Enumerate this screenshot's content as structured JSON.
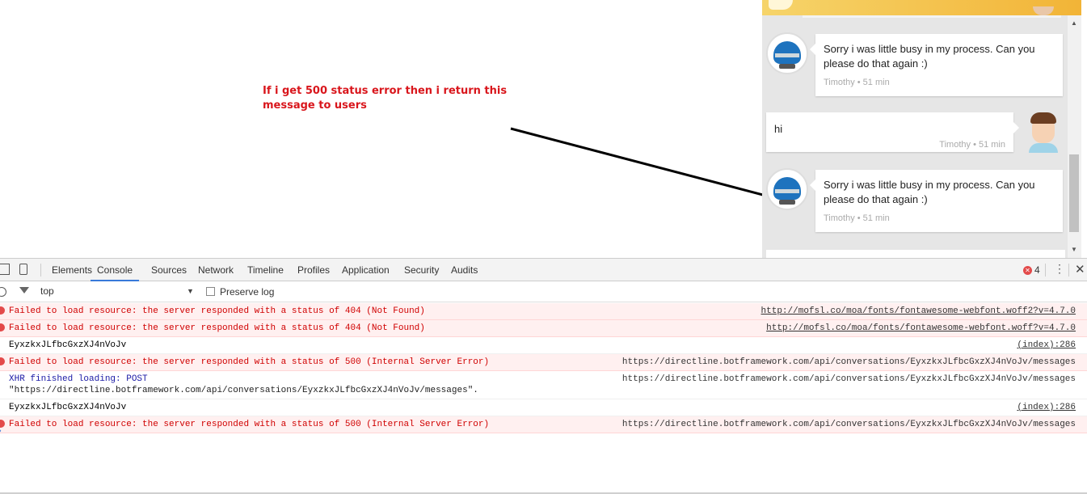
{
  "annotation": {
    "text": "If i get 500 status error then i return this message to users"
  },
  "chat": {
    "messages": [
      {
        "role": "bot",
        "text": "Sorry i was little busy in my process. Can you please do that again :)",
        "meta": "Timothy • 51 min"
      },
      {
        "role": "user",
        "text": "hi",
        "meta": "Timothy • 51 min"
      },
      {
        "role": "bot",
        "text": "Sorry i was little busy in my process. Can you please do that again :)",
        "meta": "Timothy • 51 min"
      }
    ]
  },
  "devtools": {
    "tabs": [
      "Elements",
      "Console",
      "Sources",
      "Network",
      "Timeline",
      "Profiles",
      "Application",
      "Security",
      "Audits"
    ],
    "active_tab": "Console",
    "error_count": "4",
    "context": "top",
    "preserve_log_label": "Preserve log",
    "logs": [
      {
        "type": "error",
        "text": "Failed to load resource: the server responded with a status of 404 (Not Found)",
        "source": "http://mofsl.co/moa/fonts/fontawesome-webfont.woff2?v=4.7.0"
      },
      {
        "type": "error",
        "text": "Failed to load resource: the server responded with a status of 404 (Not Found)",
        "source": "http://mofsl.co/moa/fonts/fontawesome-webfont.woff?v=4.7.0"
      },
      {
        "type": "log",
        "text": "EyxzkxJLfbcGxzXJ4nVoJv",
        "source": "(index):286"
      },
      {
        "type": "error",
        "text": "Failed to load resource: the server responded with a status of 500 (Internal Server Error)",
        "source": "https://directline.botframework.com/api/conversations/EyxzkxJLfbcGxzXJ4nVoJv/messages"
      },
      {
        "type": "xhr",
        "text": "XHR finished loading: POST",
        "text2": "\"https://directline.botframework.com/api/conversations/EyxzkxJLfbcGxzXJ4nVoJv/messages\".",
        "source": "https://directline.botframework.com/api/conversations/EyxzkxJLfbcGxzXJ4nVoJv/messages"
      },
      {
        "type": "log",
        "text": "EyxzkxJLfbcGxzXJ4nVoJv",
        "source": "(index):286"
      },
      {
        "type": "error",
        "text": "Failed to load resource: the server responded with a status of 500 (Internal Server Error)",
        "source": "https://directline.botframework.com/api/conversations/EyxzkxJLfbcGxzXJ4nVoJv/messages"
      }
    ],
    "colors": {
      "accent": "#3879d9",
      "error": "#d00000",
      "error_bg": "#fff0f0"
    }
  }
}
